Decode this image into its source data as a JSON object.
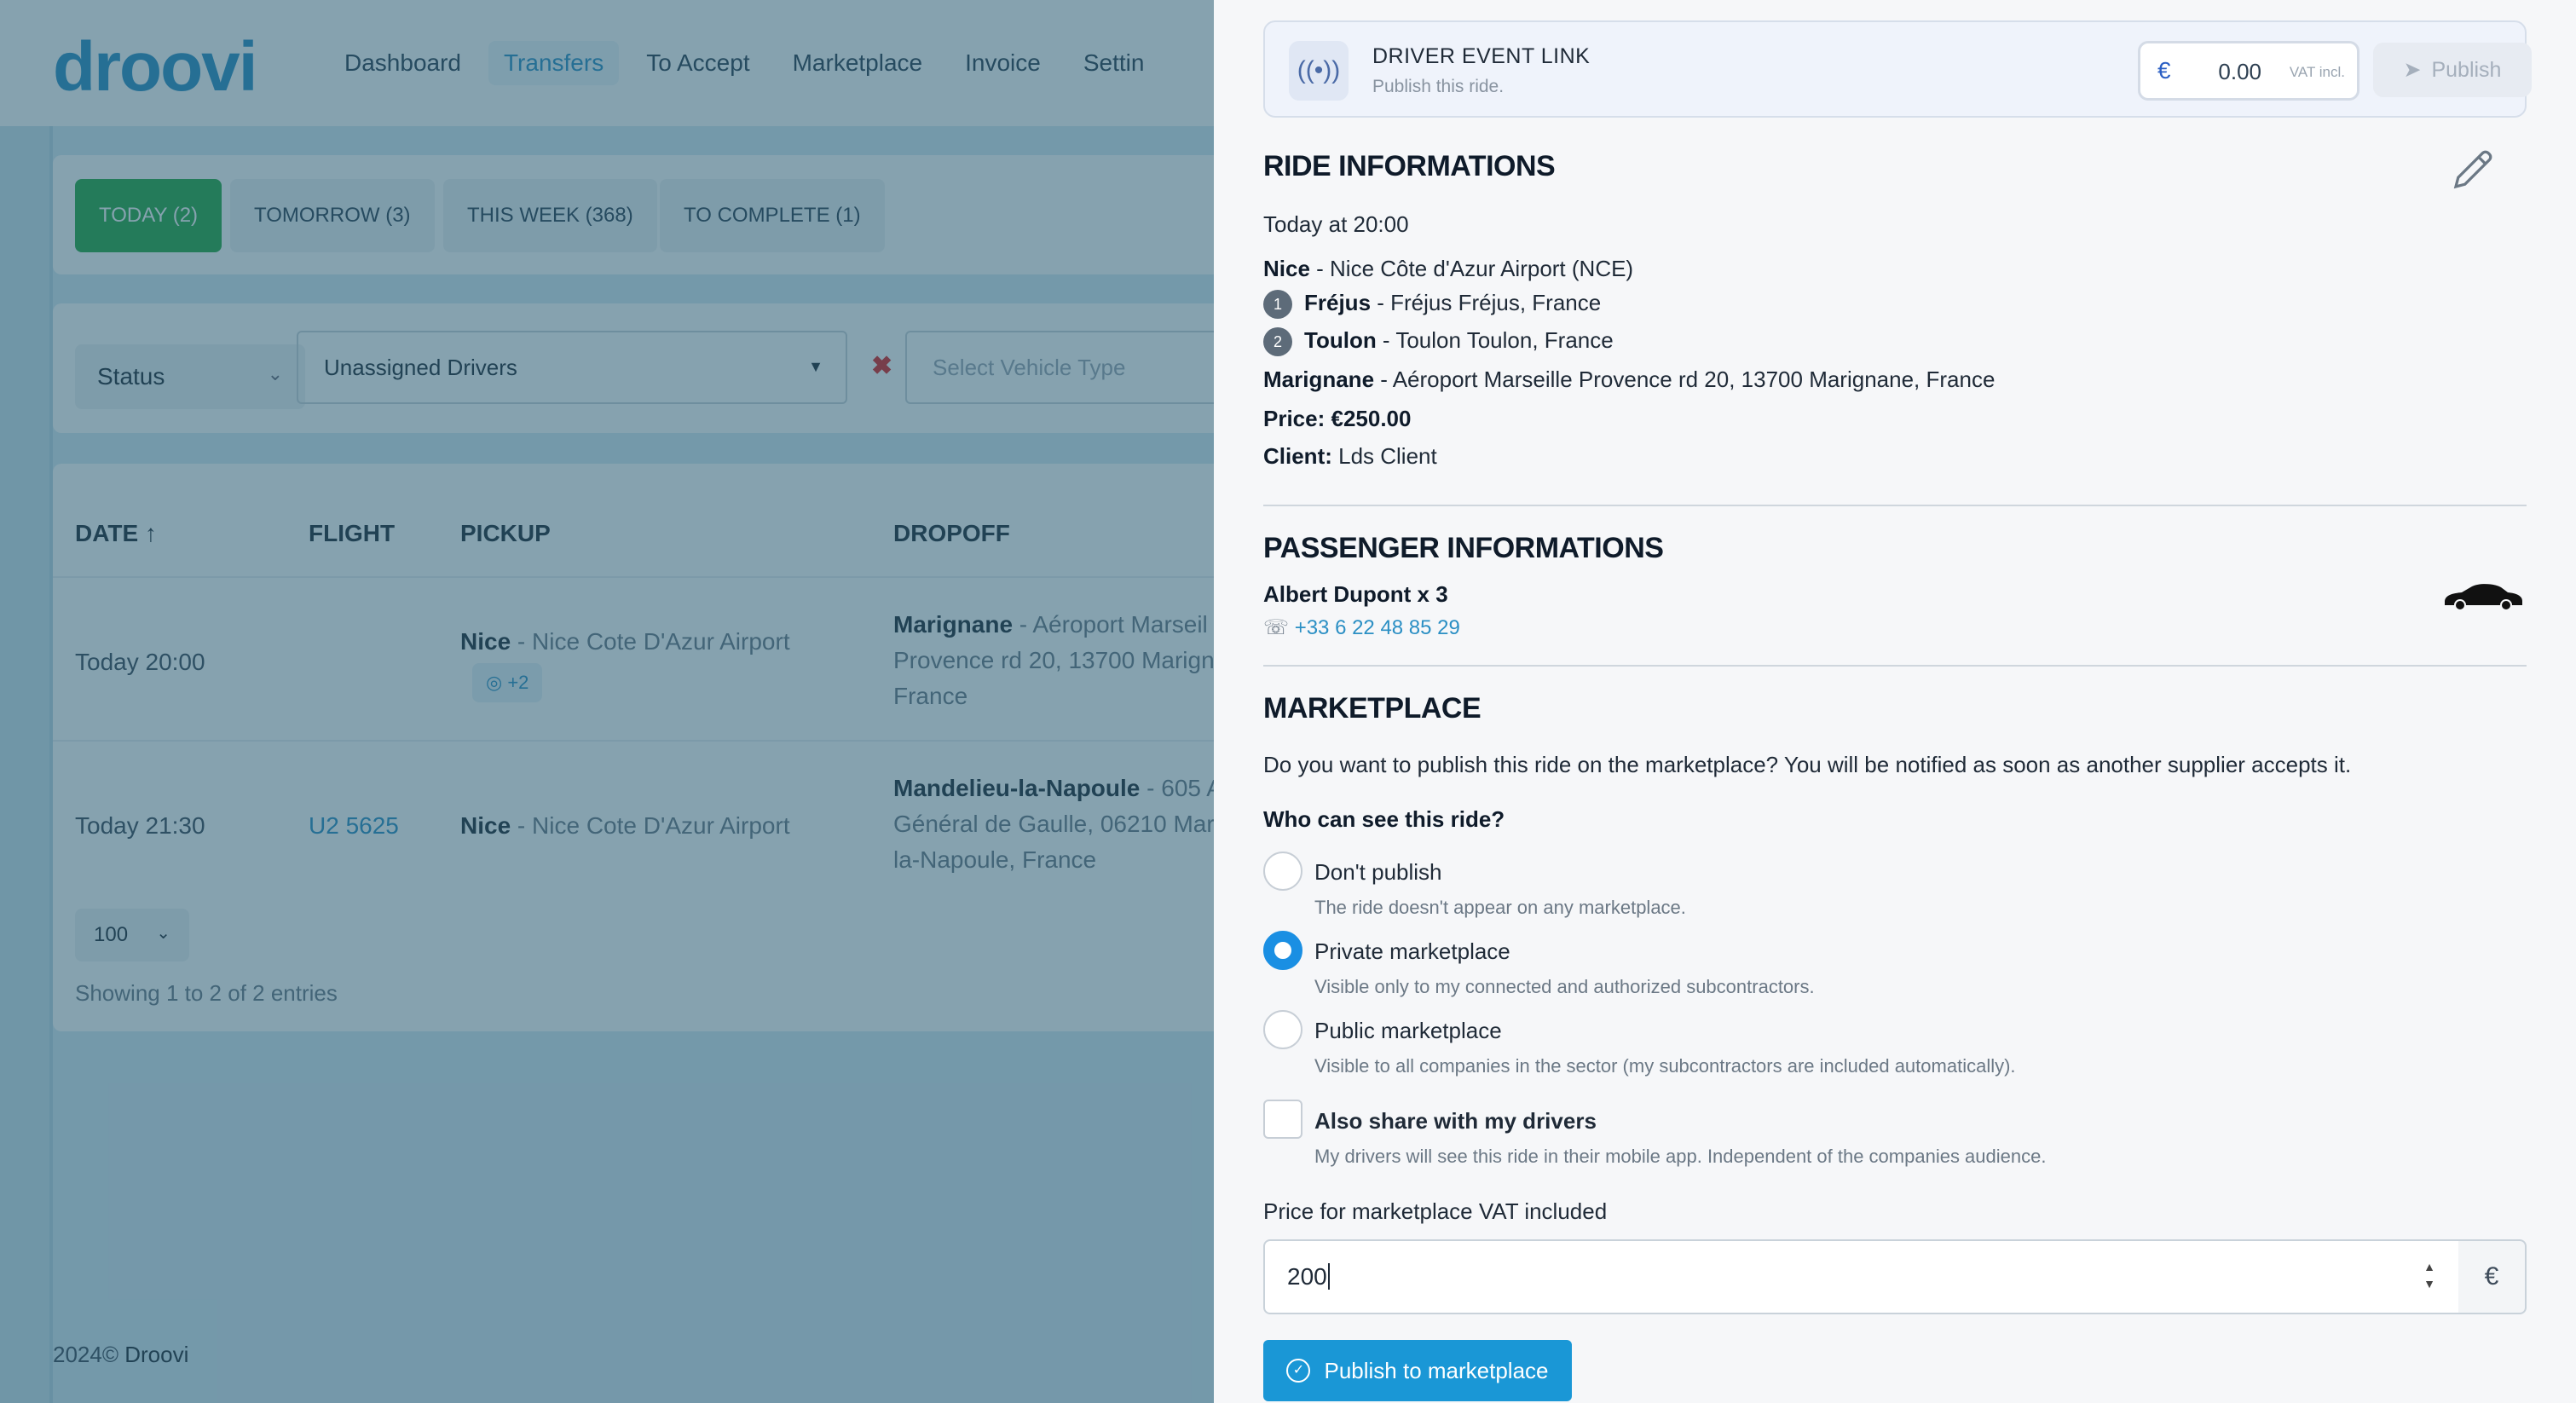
{
  "app": {
    "logo": "droovi",
    "nav": [
      "Dashboard",
      "Transfers",
      "To Accept",
      "Marketplace",
      "Invoice",
      "Settin"
    ],
    "tabs": [
      "TODAY (2)",
      "TOMORROW (3)",
      "THIS WEEK (368)",
      "TO COMPLETE (1)"
    ],
    "filters": {
      "status": "Status",
      "drivers": "Unassigned Drivers",
      "vehicle_placeholder": "Select Vehicle Type"
    },
    "table": {
      "headers": [
        "DATE ↑",
        "FLIGHT",
        "PICKUP",
        "DROPOFF"
      ],
      "rows": [
        {
          "date": "Today 20:00",
          "flight": "",
          "pickup_city": "Nice",
          "pickup_place": " - Nice Cote D'Azur Airport",
          "stops": "+2",
          "dropoff_city": "Marignane",
          "dropoff_line1": " - Aéroport Marseil",
          "dropoff_line2": "Provence rd 20, 13700 Marign",
          "dropoff_line3": "France"
        },
        {
          "date": "Today 21:30",
          "flight": "U2 5625",
          "pickup_city": "Nice",
          "pickup_place": " - Nice Cote D'Azur Airport",
          "dropoff_city": "Mandelieu-la-Napoule",
          "dropoff_line1": " - 605 A",
          "dropoff_line2": "Général de Gaulle, 06210 Mar",
          "dropoff_line3": "la-Napoule, France"
        }
      ],
      "page_size": "100",
      "showing": "Showing 1 to 2 of 2 entries"
    },
    "footer_year": "2024©",
    "footer_brand": "Droovi"
  },
  "drawer": {
    "event_link": {
      "title": "DRIVER EVENT LINK",
      "subtitle": "Publish this ride.",
      "currency": "€",
      "price": "0.00",
      "vat": "VAT incl.",
      "publish": "Publish"
    },
    "ride": {
      "title": "RIDE INFORMATIONS",
      "when": "Today at 20:00",
      "pickup_city": "Nice",
      "pickup_place": " - Nice Côte d'Azur Airport (NCE)",
      "stops": [
        {
          "n": "1",
          "city": "Fréjus",
          "place": " - Fréjus Fréjus, France"
        },
        {
          "n": "2",
          "city": "Toulon",
          "place": " - Toulon Toulon, France"
        }
      ],
      "dropoff_city": "Marignane",
      "dropoff_place": " - Aéroport Marseille Provence rd 20, 13700 Marignane, France",
      "price_label": "Price: €250.00",
      "client_label": "Client:",
      "client_value": " Lds Client"
    },
    "passenger": {
      "title": "PASSENGER INFORMATIONS",
      "name": "Albert Dupont x 3",
      "phone": "+33 6 22 48 85 29"
    },
    "marketplace": {
      "title": "MARKETPLACE",
      "question": "Do you want to publish this ride on the marketplace? You will be notified as soon as another supplier accepts it.",
      "who": "Who can see this ride?",
      "options": [
        {
          "label": "Don't publish",
          "desc": "The ride doesn't appear on any marketplace."
        },
        {
          "label": "Private marketplace",
          "desc": "Visible only to my connected and authorized subcontractors."
        },
        {
          "label": "Public marketplace",
          "desc": "Visible to all companies in the sector (my subcontractors are included automatically)."
        }
      ],
      "selected_option": "Private marketplace",
      "share_label": "Also share with my drivers",
      "share_desc": "My drivers will see this ride in their mobile app. Independent of the companies audience.",
      "share_checked": false,
      "price_label": "Price for marketplace VAT included",
      "price_value": "200",
      "currency": "€",
      "publish_button": "Publish to marketplace"
    }
  },
  "colors": {
    "accent": "#1a97d6",
    "brand": "#2b8fc4",
    "active_tab": "#27a843",
    "overlay": "#5a8ea8"
  }
}
